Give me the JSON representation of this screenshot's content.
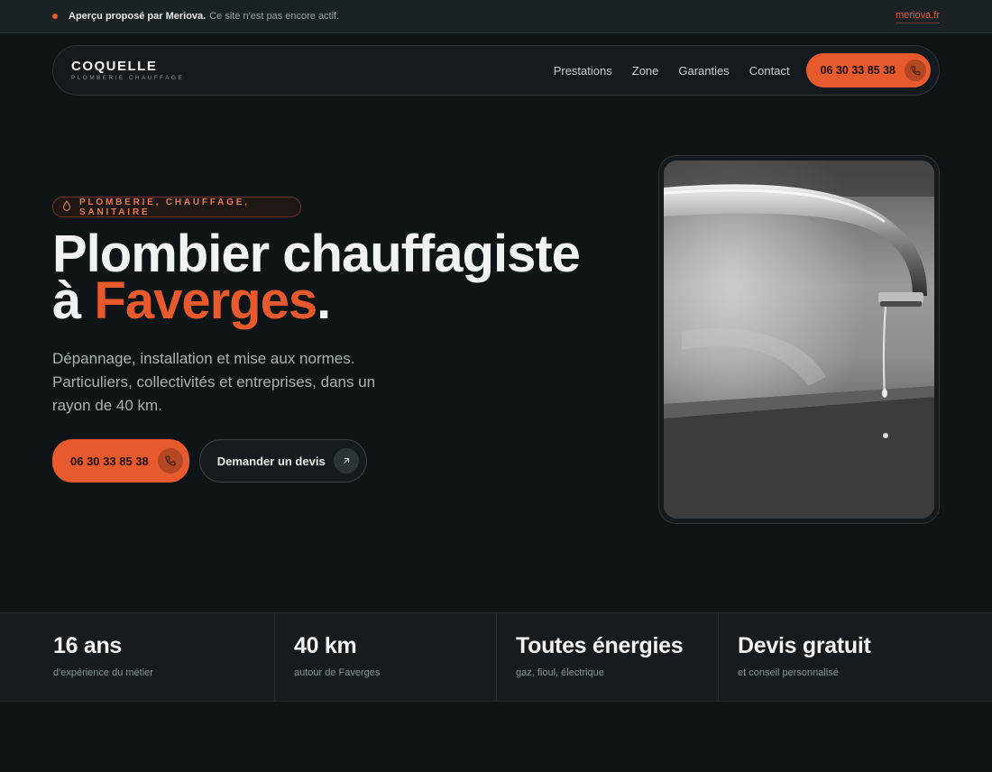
{
  "notice": {
    "bold": "Aperçu proposé par Meriova.",
    "text": "Ce site n'est pas encore actif.",
    "link": "meriova.fr"
  },
  "brand": {
    "name": "COQUELLE",
    "tagline": "PLOMBERIE CHAUFFAGE"
  },
  "nav": {
    "links": [
      "Prestations",
      "Zone",
      "Garanties",
      "Contact"
    ],
    "phone": "06 30 33 85 38"
  },
  "hero": {
    "badge": "PLOMBERIE, CHAUFFAGE, SANITAIRE",
    "title_line1": "Plombier chauffagiste",
    "title_prefix": "à",
    "title_accent": "Faverges",
    "title_suffix": ".",
    "lead": "Dépannage, installation et mise aux normes. Particuliers, collectivités et entreprises, dans un rayon de 40 km.",
    "phone_button": "06 30 33 85 38",
    "quote_button": "Demander un devis"
  },
  "stats": [
    {
      "value": "16 ans",
      "label": "d'expérience du métier"
    },
    {
      "value": "40 km",
      "label": "autour de Faverges"
    },
    {
      "value": "Toutes énergies",
      "label": "gaz, fioul, électrique"
    },
    {
      "value": "Devis gratuit",
      "label": "et conseil personnalisé"
    }
  ],
  "colors": {
    "accent": "#e65a2d",
    "background": "#0f1417"
  },
  "icons": {
    "phone": "phone-icon",
    "arrow": "arrow-up-right-icon",
    "drop": "water-drop-icon"
  }
}
